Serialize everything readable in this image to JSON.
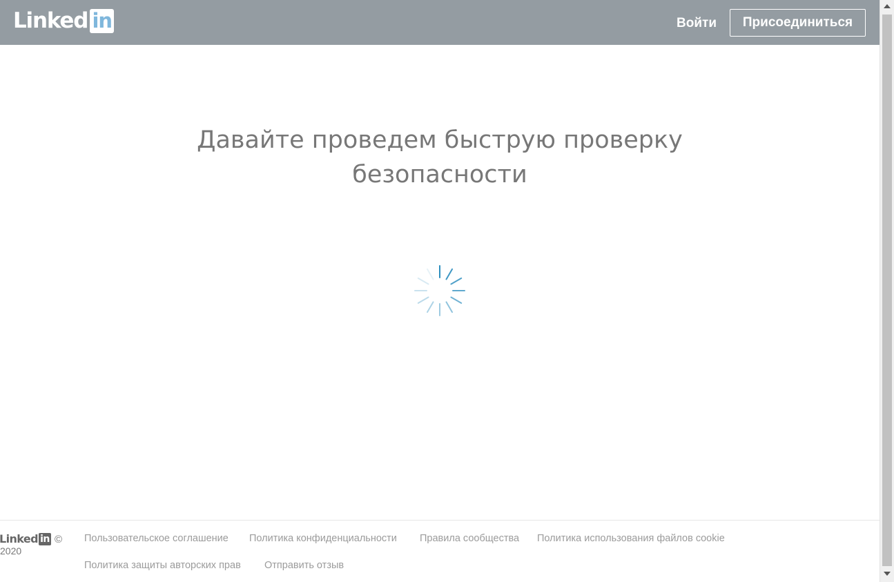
{
  "header": {
    "logo": {
      "word": "Linked",
      "box": "in"
    },
    "sign_in_label": "Войти",
    "join_label": "Присоединиться"
  },
  "main": {
    "title_line1": "Давайте проведем быструю проверку",
    "title_line2": "безопасности",
    "spinner_icon": "loading-spinner-icon"
  },
  "footer": {
    "logo": {
      "word": "Linked",
      "box": "in"
    },
    "copyright_symbol": "©",
    "year": "2020",
    "links": [
      "Пользовательское соглашение",
      "Политика конфиденциальности",
      "Правила сообщества",
      "Политика использования файлов cookie",
      "Политика защиты авторских прав",
      "Отправить отзыв"
    ]
  },
  "colors": {
    "header_bg": "#949ca2",
    "logo_in": "#7fb7dc",
    "spinner": "#2e8fbf",
    "text_gray": "#777777"
  }
}
